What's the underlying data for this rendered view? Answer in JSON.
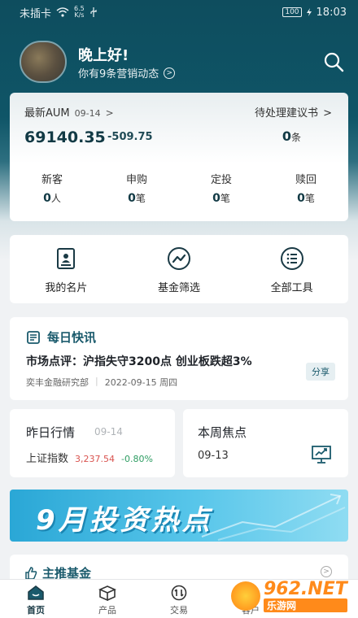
{
  "status_bar": {
    "carrier": "未插卡",
    "speed_value": "6.5",
    "speed_unit": "K/s",
    "battery": "100",
    "time": "18:03"
  },
  "profile": {
    "greeting": "晚上好!",
    "subtitle": "你有9条营销动态"
  },
  "aum": {
    "label": "最新AUM",
    "date": "09-14",
    "value": "69140.35",
    "change": "-509.75",
    "pending_label": "待处理建议书",
    "pending_count": "0",
    "pending_unit": "条",
    "stats": [
      {
        "label": "新客",
        "value": "0",
        "unit": "人"
      },
      {
        "label": "申购",
        "value": "0",
        "unit": "笔"
      },
      {
        "label": "定投",
        "value": "0",
        "unit": "笔"
      },
      {
        "label": "赎回",
        "value": "0",
        "unit": "笔"
      }
    ]
  },
  "tools": [
    {
      "label": "我的名片",
      "icon": "business-card-icon"
    },
    {
      "label": "基金筛选",
      "icon": "trend-chart-icon"
    },
    {
      "label": "全部工具",
      "icon": "list-icon"
    }
  ],
  "news": {
    "header": "每日快讯",
    "title": "市场点评：沪指失守3200点 创业板跌超3%",
    "source": "奕丰金融研究部",
    "date": "2022-09-15 周四",
    "share_label": "分享"
  },
  "market": {
    "title": "昨日行情",
    "date": "09-14",
    "index_name": "上证指数",
    "index_value": "3,237.54",
    "index_change": "-0.80%"
  },
  "focus": {
    "title": "本周焦点",
    "date": "09-13"
  },
  "banner": {
    "text": "9月投资热点"
  },
  "featured": {
    "header": "主推基金"
  },
  "tabbar": [
    {
      "label": "首页",
      "active": true
    },
    {
      "label": "产品",
      "active": false
    },
    {
      "label": "交易",
      "active": false
    },
    {
      "label": "客户",
      "active": false
    }
  ],
  "watermark": {
    "big": "962.NET",
    "small": "乐游网"
  },
  "colors": {
    "brand_dark": "#0e4d5e",
    "accent": "#1a5a6c",
    "down_red": "#d9534f",
    "change_green": "#2e9d63"
  }
}
